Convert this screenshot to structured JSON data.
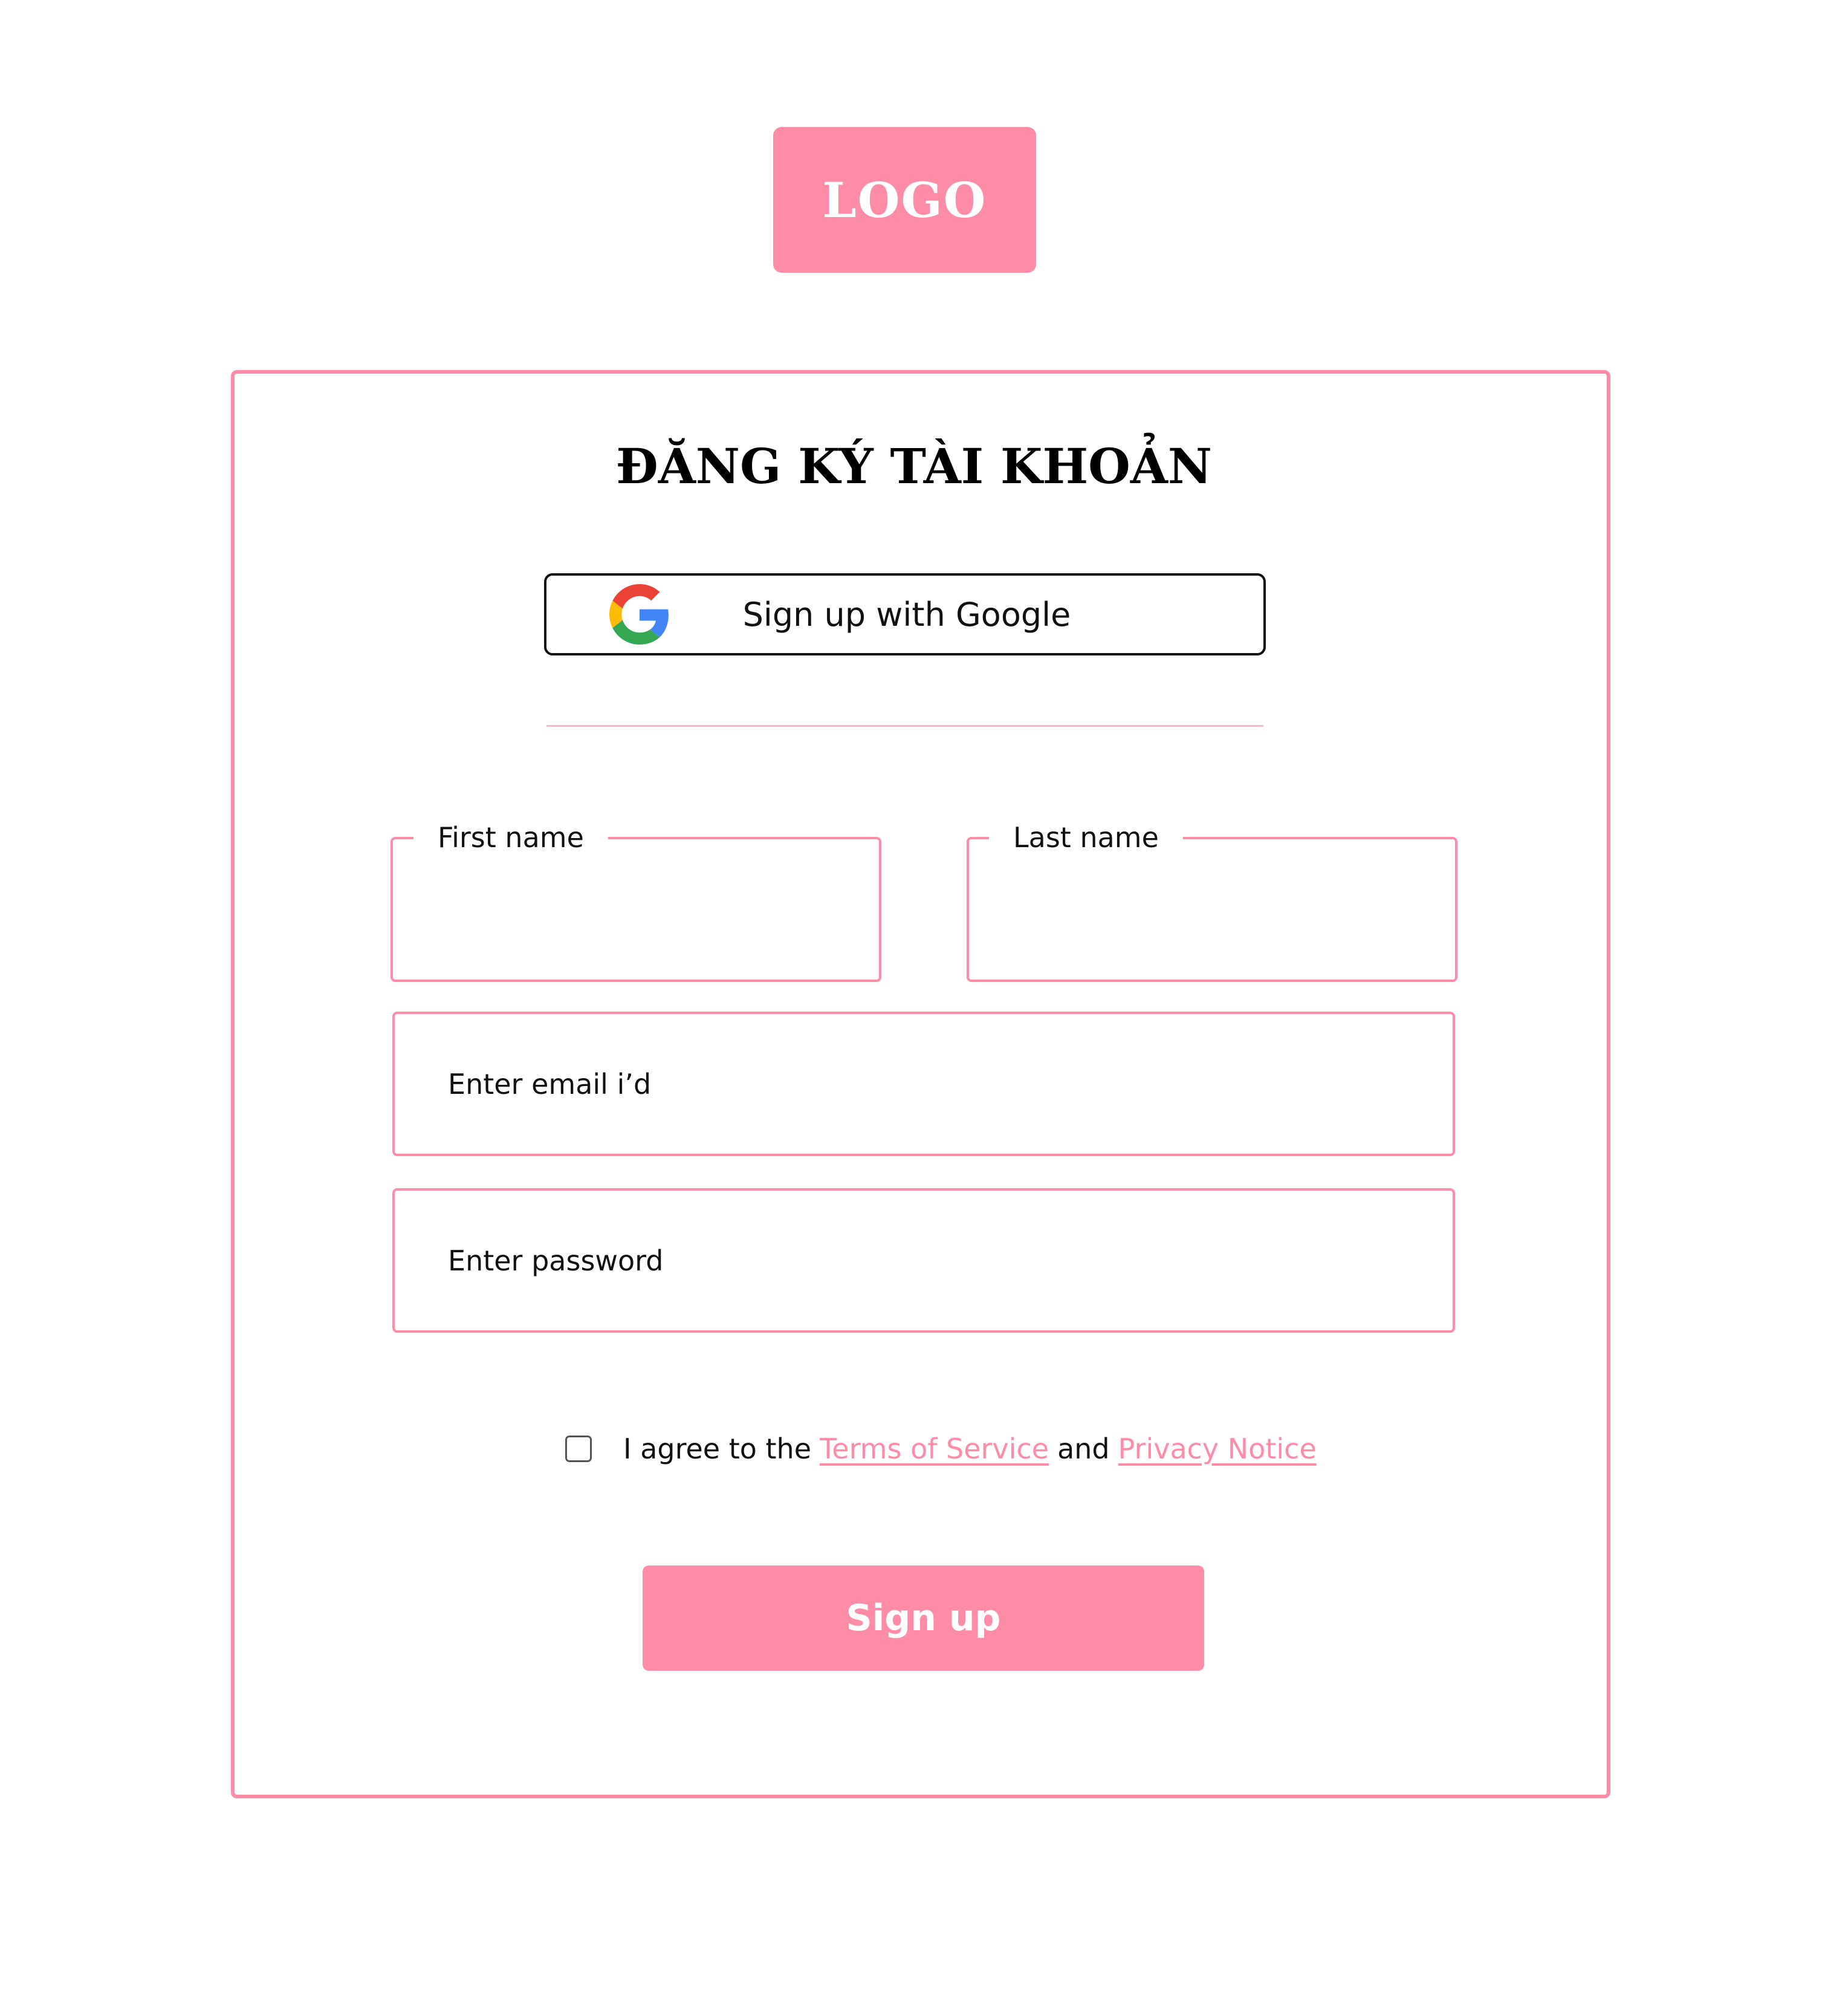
{
  "logo": {
    "text": "LOGO"
  },
  "form": {
    "title": "ĐĂNG KÝ TÀI KHOẢN",
    "google_button_label": "Sign up with Google",
    "first_name_label": "First name",
    "last_name_label": "Last name",
    "email_placeholder": "Enter email i’d",
    "password_placeholder": "Enter password",
    "agree": {
      "prefix": "I agree to the",
      "terms_link": "Terms of Service",
      "conjunction": "and",
      "privacy_link": "Privacy Notice",
      "checked": false
    },
    "submit_label": "Sign up"
  },
  "icons": {
    "google": "google-logo-icon"
  },
  "colors": {
    "accent": "#ff8ca6",
    "divider": "#ffb3c4",
    "text": "#111111",
    "background": "#ffffff"
  }
}
